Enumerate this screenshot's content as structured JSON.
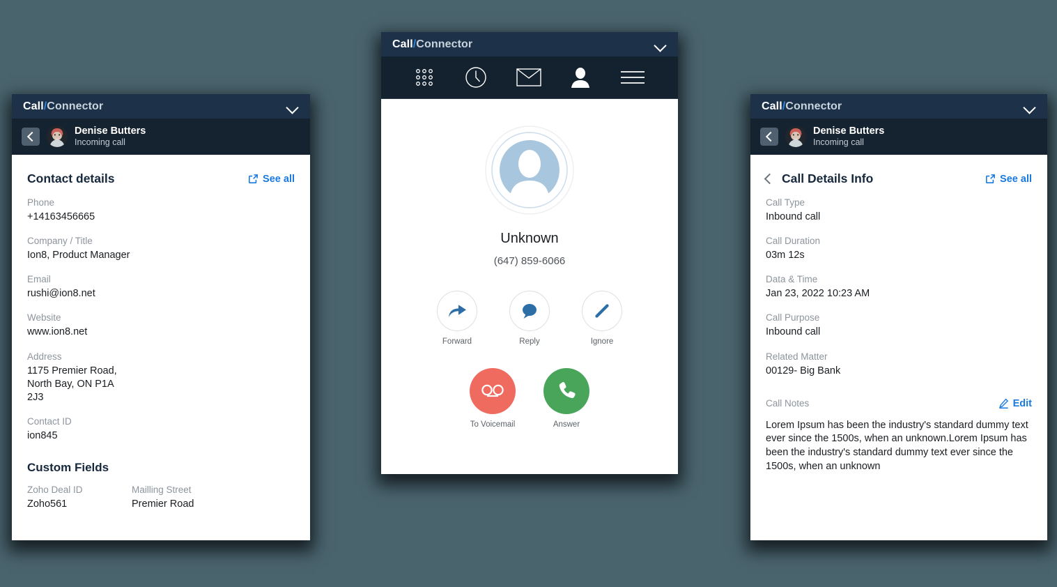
{
  "app": {
    "brand_bold": "Call",
    "brand_slash": "/",
    "brand_light": "Connector",
    "accent_blue": "#1a7ae0",
    "header_navy": "#1d3148",
    "contactbar_navy": "#15222f",
    "page_bg": "#4a646e"
  },
  "contact_header": {
    "name": "Denise Butters",
    "status": "Incoming call"
  },
  "left_panel": {
    "section_title": "Contact details",
    "see_all_label": "See all",
    "fields": [
      {
        "label": "Phone",
        "value": "+14163456665"
      },
      {
        "label": "Company / Title",
        "value": "Ion8, Product Manager"
      },
      {
        "label": "Email",
        "value": "rushi@ion8.net"
      },
      {
        "label": "Website",
        "value": "www.ion8.net"
      },
      {
        "label": "Address",
        "value": "1175 Premier Road, North Bay, ON P1A 2J3"
      },
      {
        "label": "Contact ID",
        "value": "ion845"
      }
    ],
    "custom_fields_title": "Custom Fields",
    "custom_fields": [
      {
        "label": "Zoho Deal ID",
        "value": "Zoho561"
      },
      {
        "label": "Mailling Street",
        "value": "Premier Road"
      }
    ]
  },
  "middle_panel": {
    "nav_items": [
      {
        "name": "dialpad-icon"
      },
      {
        "name": "clock-icon"
      },
      {
        "name": "envelope-icon"
      },
      {
        "name": "person-icon"
      },
      {
        "name": "hamburger-menu-icon"
      }
    ],
    "caller_name": "Unknown",
    "caller_number": "(647) 859-6066",
    "actions": [
      {
        "label": "Forward",
        "icon": "forward-arrow-icon"
      },
      {
        "label": "Reply",
        "icon": "chat-bubble-icon"
      },
      {
        "label": "Ignore",
        "icon": "pencil-icon"
      }
    ],
    "call_actions": [
      {
        "label": "To Voicemail",
        "icon": "voicemail-icon",
        "color": "#ef6a5f"
      },
      {
        "label": "Answer",
        "icon": "phone-handset-icon",
        "color": "#49a55a"
      }
    ]
  },
  "right_panel": {
    "section_title": "Call Details Info",
    "see_all_label": "See all",
    "fields": [
      {
        "label": "Call Type",
        "value": "Inbound call"
      },
      {
        "label": "Call Duration",
        "value": "03m 12s"
      },
      {
        "label": "Data & Time",
        "value": "Jan 23, 2022 10:23 AM"
      },
      {
        "label": "Call Purpose",
        "value": "Inbound call"
      },
      {
        "label": "Related Matter",
        "value": "00129- Big Bank"
      }
    ],
    "notes_label": "Call Notes",
    "edit_label": "Edit",
    "notes_text": "Lorem Ipsum has been the industry's standard dummy text ever since the 1500s, when an unknown.Lorem Ipsum has been the industry's standard dummy text ever since the 1500s, when an unknown"
  }
}
